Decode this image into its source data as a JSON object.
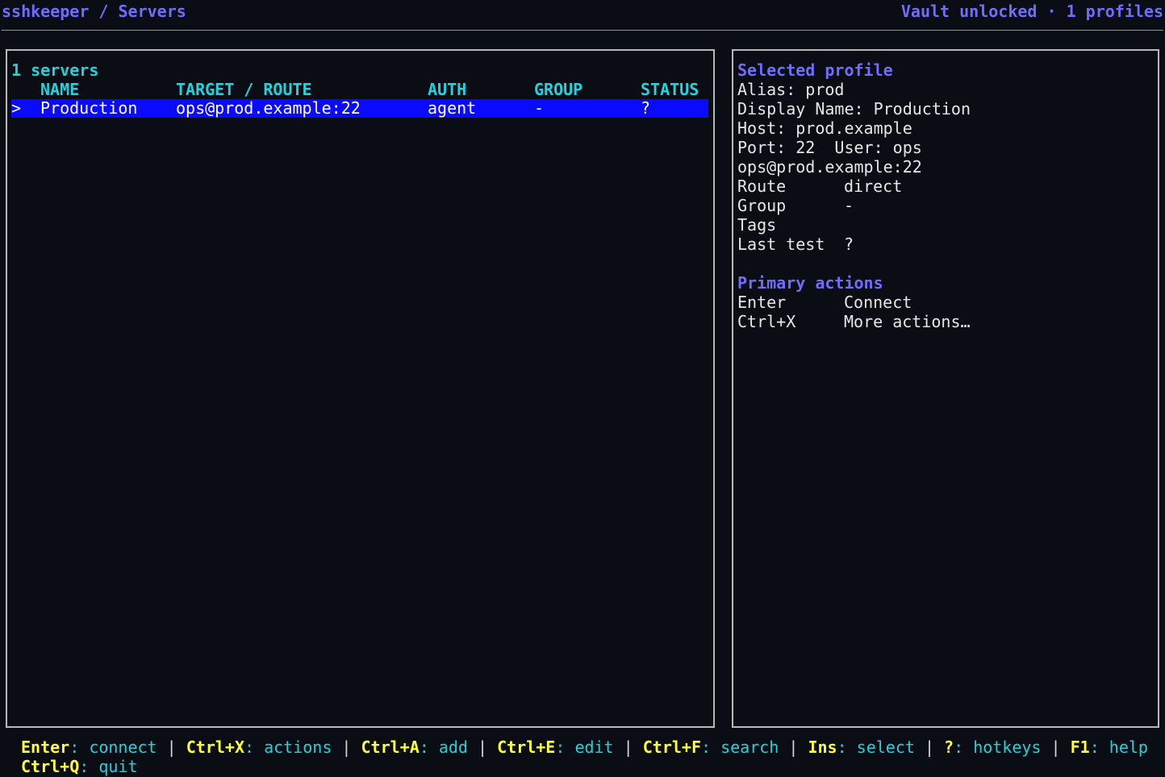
{
  "header": {
    "breadcrumb": "sshkeeper / Servers",
    "status": "Vault unlocked · 1 profiles"
  },
  "server_list": {
    "count_label": "1 servers",
    "columns": [
      "NAME",
      "TARGET / ROUTE",
      "AUTH",
      "GROUP",
      "STATUS"
    ],
    "rows": [
      {
        "marker": ">",
        "name": "Production",
        "target": "ops@prod.example:22",
        "auth": "agent",
        "group": "-",
        "status": "?"
      }
    ]
  },
  "details": {
    "heading": "Selected profile",
    "lines": [
      "Alias: prod",
      "Display Name: Production",
      "Host: prod.example",
      "Port: 22  User: ops",
      "ops@prod.example:22"
    ],
    "fields": [
      {
        "label": "Route",
        "value": "direct"
      },
      {
        "label": "Group",
        "value": "-"
      },
      {
        "label": "Tags",
        "value": ""
      },
      {
        "label": "Last test",
        "value": "?"
      }
    ],
    "actions_heading": "Primary actions",
    "actions": [
      {
        "key": "Enter",
        "label": "Connect"
      },
      {
        "key": "Ctrl+X",
        "label": "More actions…"
      }
    ]
  },
  "footer": {
    "separator": " | ",
    "hotkeys": [
      {
        "key": "Enter",
        "label": "connect"
      },
      {
        "key": "Ctrl+X",
        "label": "actions"
      },
      {
        "key": "Ctrl+A",
        "label": "add"
      },
      {
        "key": "Ctrl+E",
        "label": "edit"
      },
      {
        "key": "Ctrl+F",
        "label": "search"
      },
      {
        "key": "Ins",
        "label": "select"
      },
      {
        "key": "?",
        "label": "hotkeys"
      },
      {
        "key": "F1",
        "label": "help"
      },
      {
        "key": "Ctrl+Q",
        "label": "quit"
      }
    ]
  },
  "colors": {
    "background": "#0a0e14",
    "accent_purple": "#6f6cff",
    "accent_cyan": "#22d3dd",
    "selection": "#0a0aff",
    "hotkey_yellow": "#ffff33",
    "border": "#b9b9b9"
  }
}
